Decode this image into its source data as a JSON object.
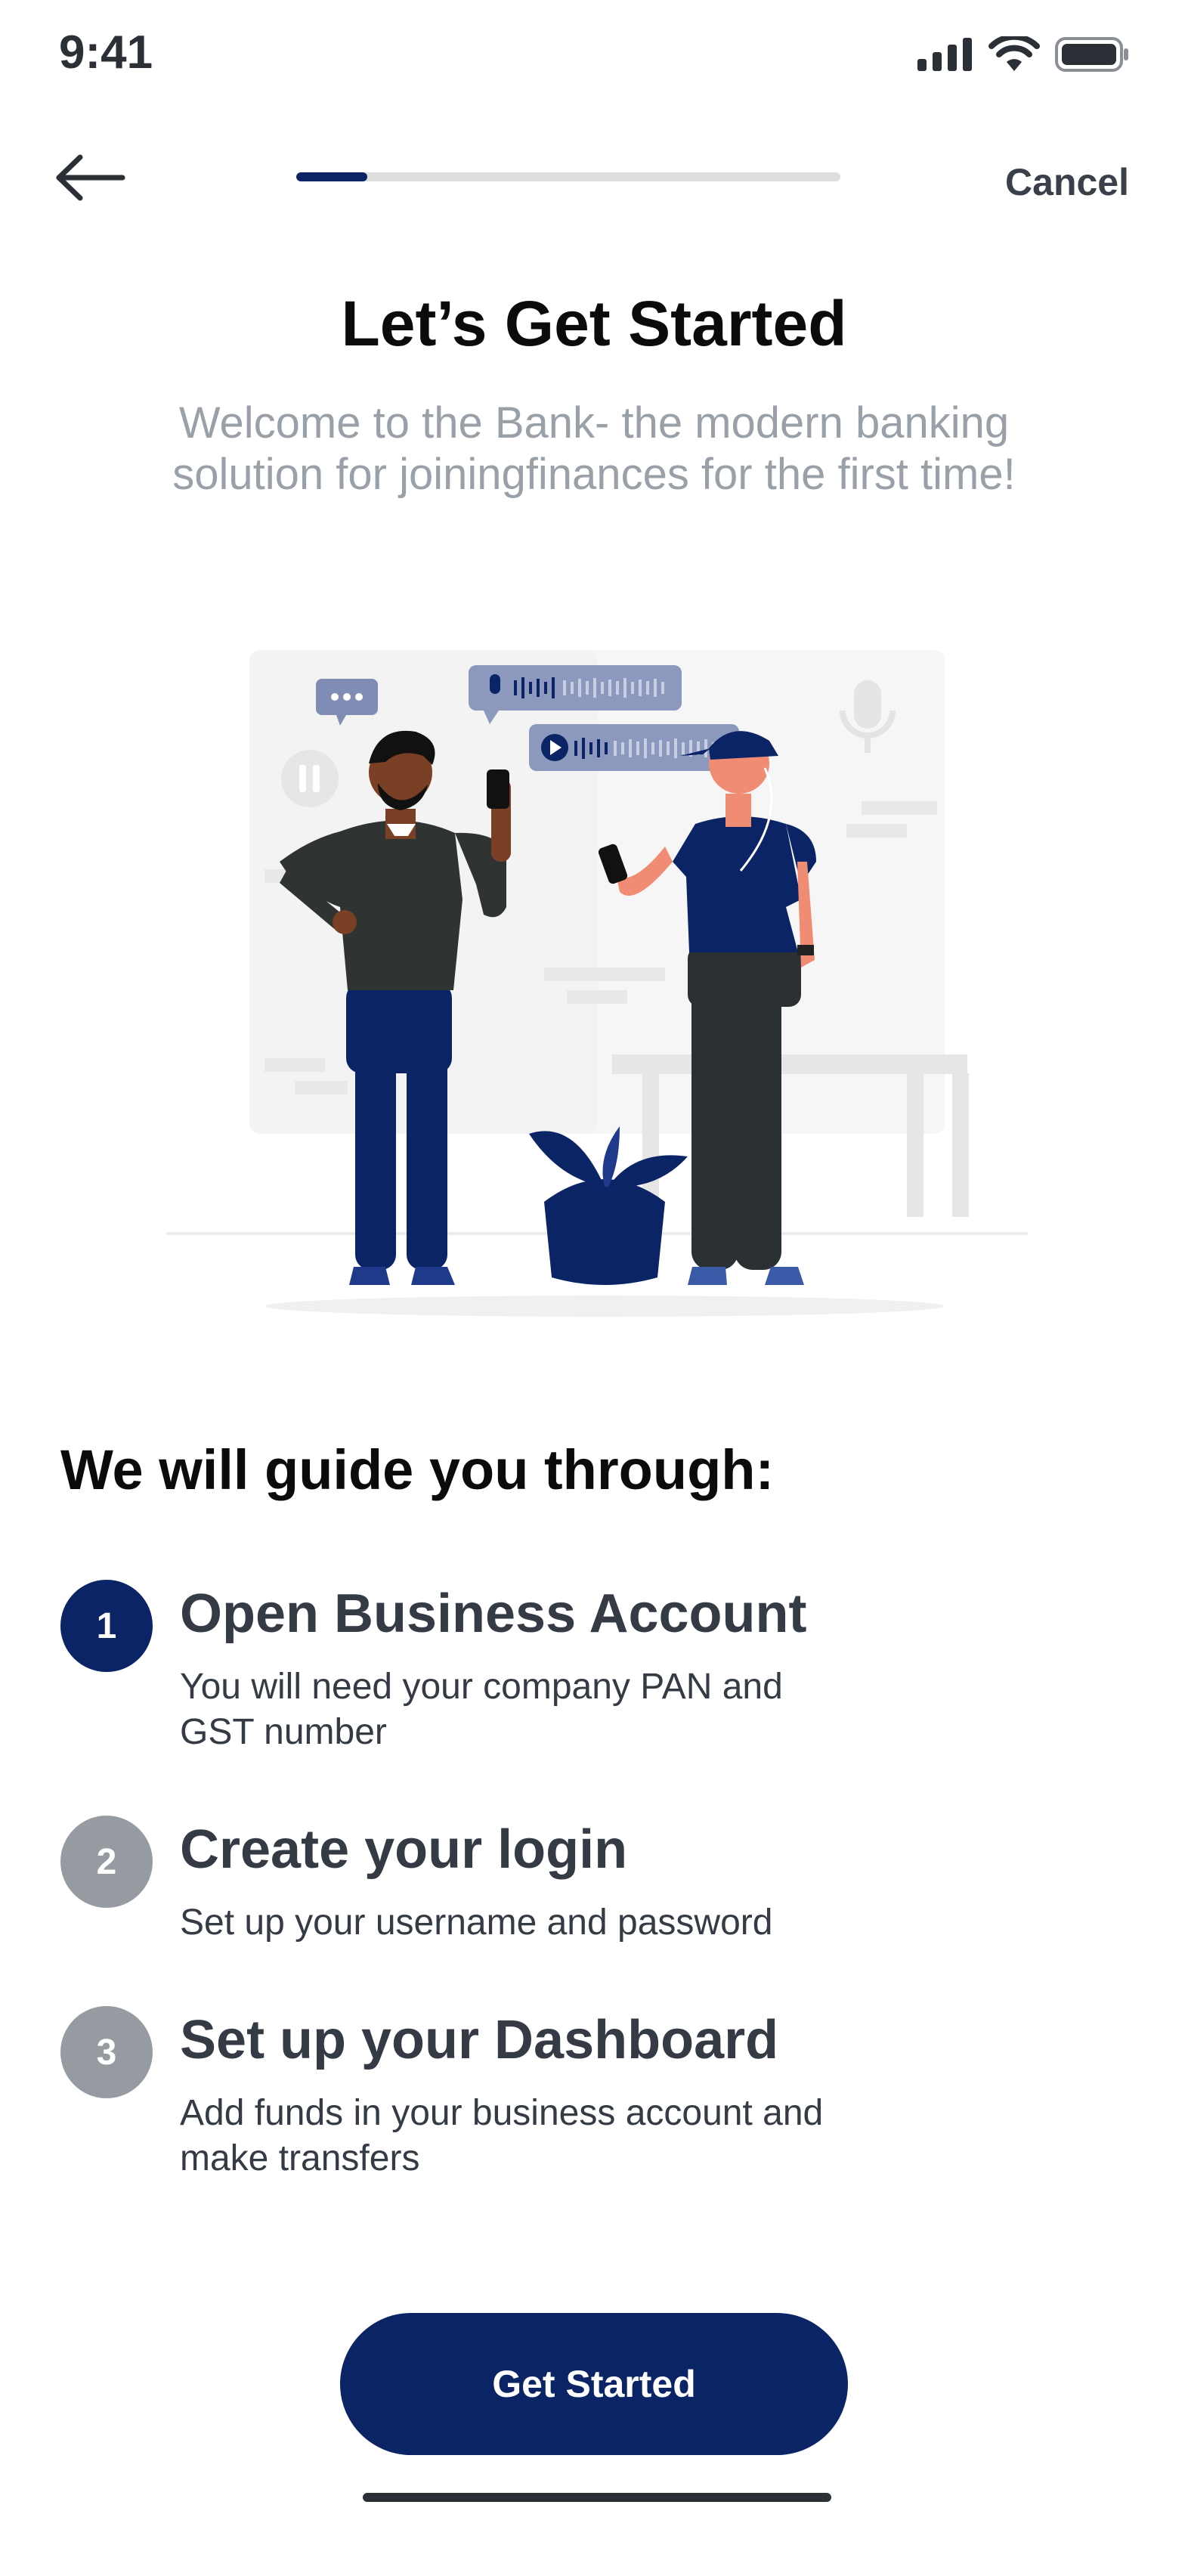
{
  "status_bar": {
    "time": "9:41"
  },
  "nav": {
    "back_icon": "arrow-left-icon",
    "cancel_label": "Cancel",
    "progress_fraction": 0.13
  },
  "header": {
    "title": "Let’s Get Started",
    "subtitle": "Welcome to the Bank- the modern banking solution for joiningfinances for the first time!"
  },
  "guide": {
    "title": "We will guide you through:",
    "steps": [
      {
        "number": "1",
        "title": "Open Business Account",
        "description": "You will need your company PAN and GST number",
        "state": "active"
      },
      {
        "number": "2",
        "title": "Create your login",
        "description": "Set up your username and password",
        "state": "inactive"
      },
      {
        "number": "3",
        "title": "Set up your Dashboard",
        "description": "Add funds in your business account and make transfers",
        "state": "inactive"
      }
    ]
  },
  "cta": {
    "label": "Get Started"
  },
  "colors": {
    "brand": "#0a2466",
    "inactive_step": "#969ba2",
    "subtitle": "#9aa0a8",
    "progress_track": "#dedede"
  }
}
